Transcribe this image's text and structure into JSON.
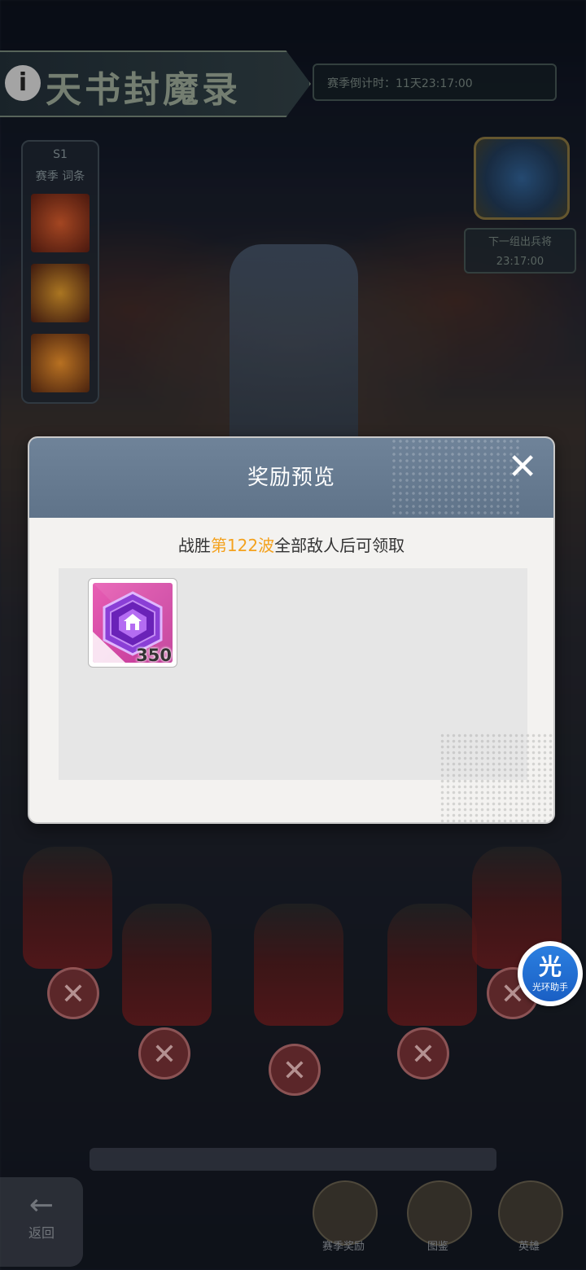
{
  "background": {
    "banner_title": "天书封魔录",
    "banner_info_icon": "i",
    "season_text": "赛季倒计时：11天23:17:00",
    "left_panel": {
      "label_top": "S1",
      "label_sub": "赛季 词条"
    },
    "next_reset": {
      "line1": "下一组出兵将",
      "line2": "23:17:00"
    },
    "hint": "",
    "back_button": {
      "arrow": "←",
      "label": "返回"
    },
    "bottom_icons": [
      "赛季奖励",
      "图鉴",
      "英雄"
    ]
  },
  "dialog": {
    "title": "奖励预览",
    "close_icon": "✕",
    "condition": {
      "prefix": "战胜",
      "highlight": "第122波",
      "suffix": "全部敌人后可领取"
    },
    "accent_color": "#f4a21e",
    "rewards": [
      {
        "icon": "purple-house-token-icon",
        "count": "350"
      }
    ]
  },
  "assistant": {
    "char": "光",
    "label": "光环助手"
  }
}
